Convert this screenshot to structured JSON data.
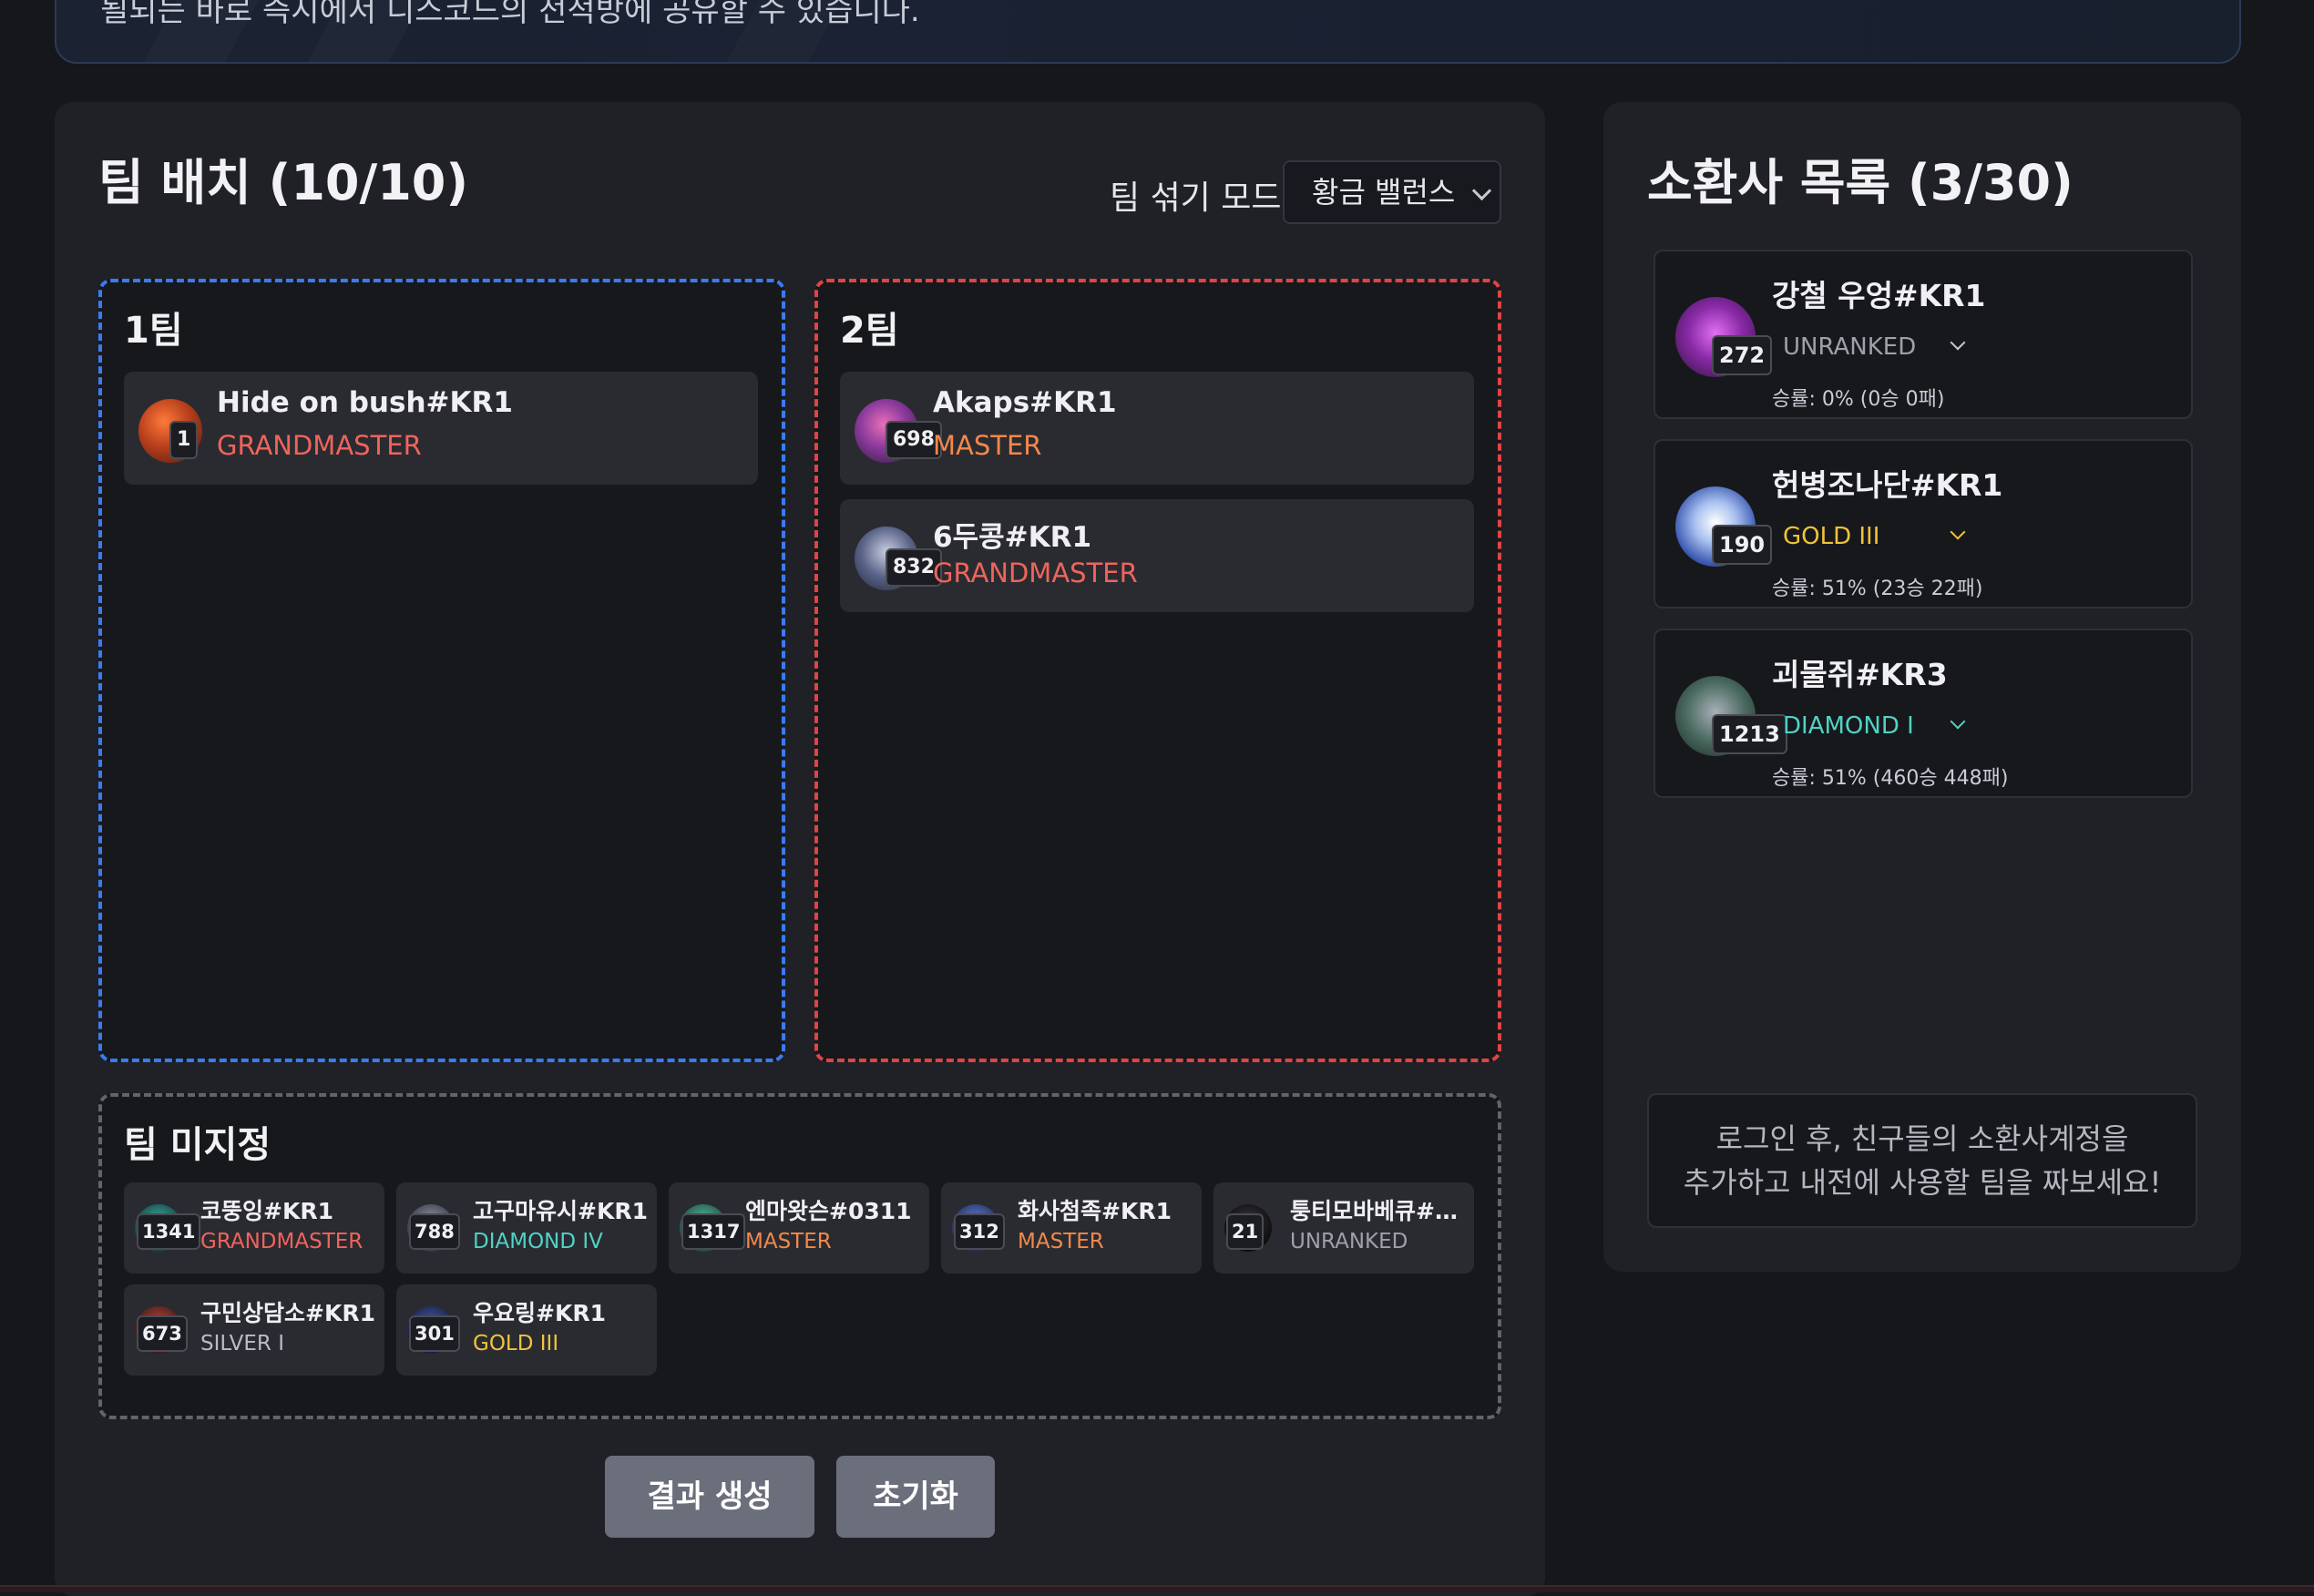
{
  "banner": {
    "text": "될되는 바로 즉시에서 디스코드의 전적방에 공유할 수 있습니다."
  },
  "team_panel": {
    "title": "팀 배치 (10/10)",
    "mix_mode_label": "팀 섞기 모드",
    "mix_mode_value": "황금 밸런스",
    "team1": {
      "title": "1팀",
      "players": [
        {
          "name": "Hide on bush#KR1",
          "level": "1",
          "tier": "GRANDMASTER"
        }
      ]
    },
    "team2": {
      "title": "2팀",
      "players": [
        {
          "name": "Akaps#KR1",
          "level": "698",
          "tier": "MASTER"
        },
        {
          "name": "6두콩#KR1",
          "level": "832",
          "tier": "GRANDMASTER"
        }
      ]
    },
    "unassigned": {
      "title": "팀 미지정",
      "players": [
        {
          "name": "코뚱잉#KR1",
          "level": "1341",
          "tier": "GRANDMASTER"
        },
        {
          "name": "고구마유시#KR1",
          "level": "788",
          "tier": "DIAMOND IV"
        },
        {
          "name": "엔마왓슨#0311",
          "level": "1317",
          "tier": "MASTER"
        },
        {
          "name": "화사첨족#KR1",
          "level": "312",
          "tier": "MASTER"
        },
        {
          "name": "퉁티모바베큐#0…",
          "level": "21",
          "tier": "UNRANKED"
        },
        {
          "name": "구민상담소#KR1",
          "level": "673",
          "tier": "SILVER I"
        },
        {
          "name": "우요링#KR1",
          "level": "301",
          "tier": "GOLD III"
        }
      ]
    },
    "generate_label": "결과 생성",
    "reset_label": "초기화"
  },
  "summoner_panel": {
    "title": "소환사 목록 (3/30)",
    "summoners": [
      {
        "name": "강철 우엉#KR1",
        "level": "272",
        "tier": "UNRANKED",
        "winrate": "승률: 0% (0승 0패)"
      },
      {
        "name": "헌병조나단#KR1",
        "level": "190",
        "tier": "GOLD III",
        "winrate": "승률: 51% (23승 22패)"
      },
      {
        "name": "괴물쥐#KR3",
        "level": "1213",
        "tier": "DIAMOND I",
        "winrate": "승률: 51% (460승 448패)"
      }
    ],
    "login_note_line1": "로그인 후, 친구들의 소환사계정을",
    "login_note_line2": "추가하고 내전에 사용할 팀을 짜보세요!"
  },
  "colors": {
    "team1_border": "#3b7bf0",
    "team2_border": "#e04444",
    "grandmaster": "#f0645a",
    "master": "#f4884a",
    "diamond": "#4fd3c4",
    "gold": "#f0c33c",
    "silver": "#b8bcc6",
    "unranked": "#9ea0aa",
    "button_bg": "#6b6f7b"
  }
}
